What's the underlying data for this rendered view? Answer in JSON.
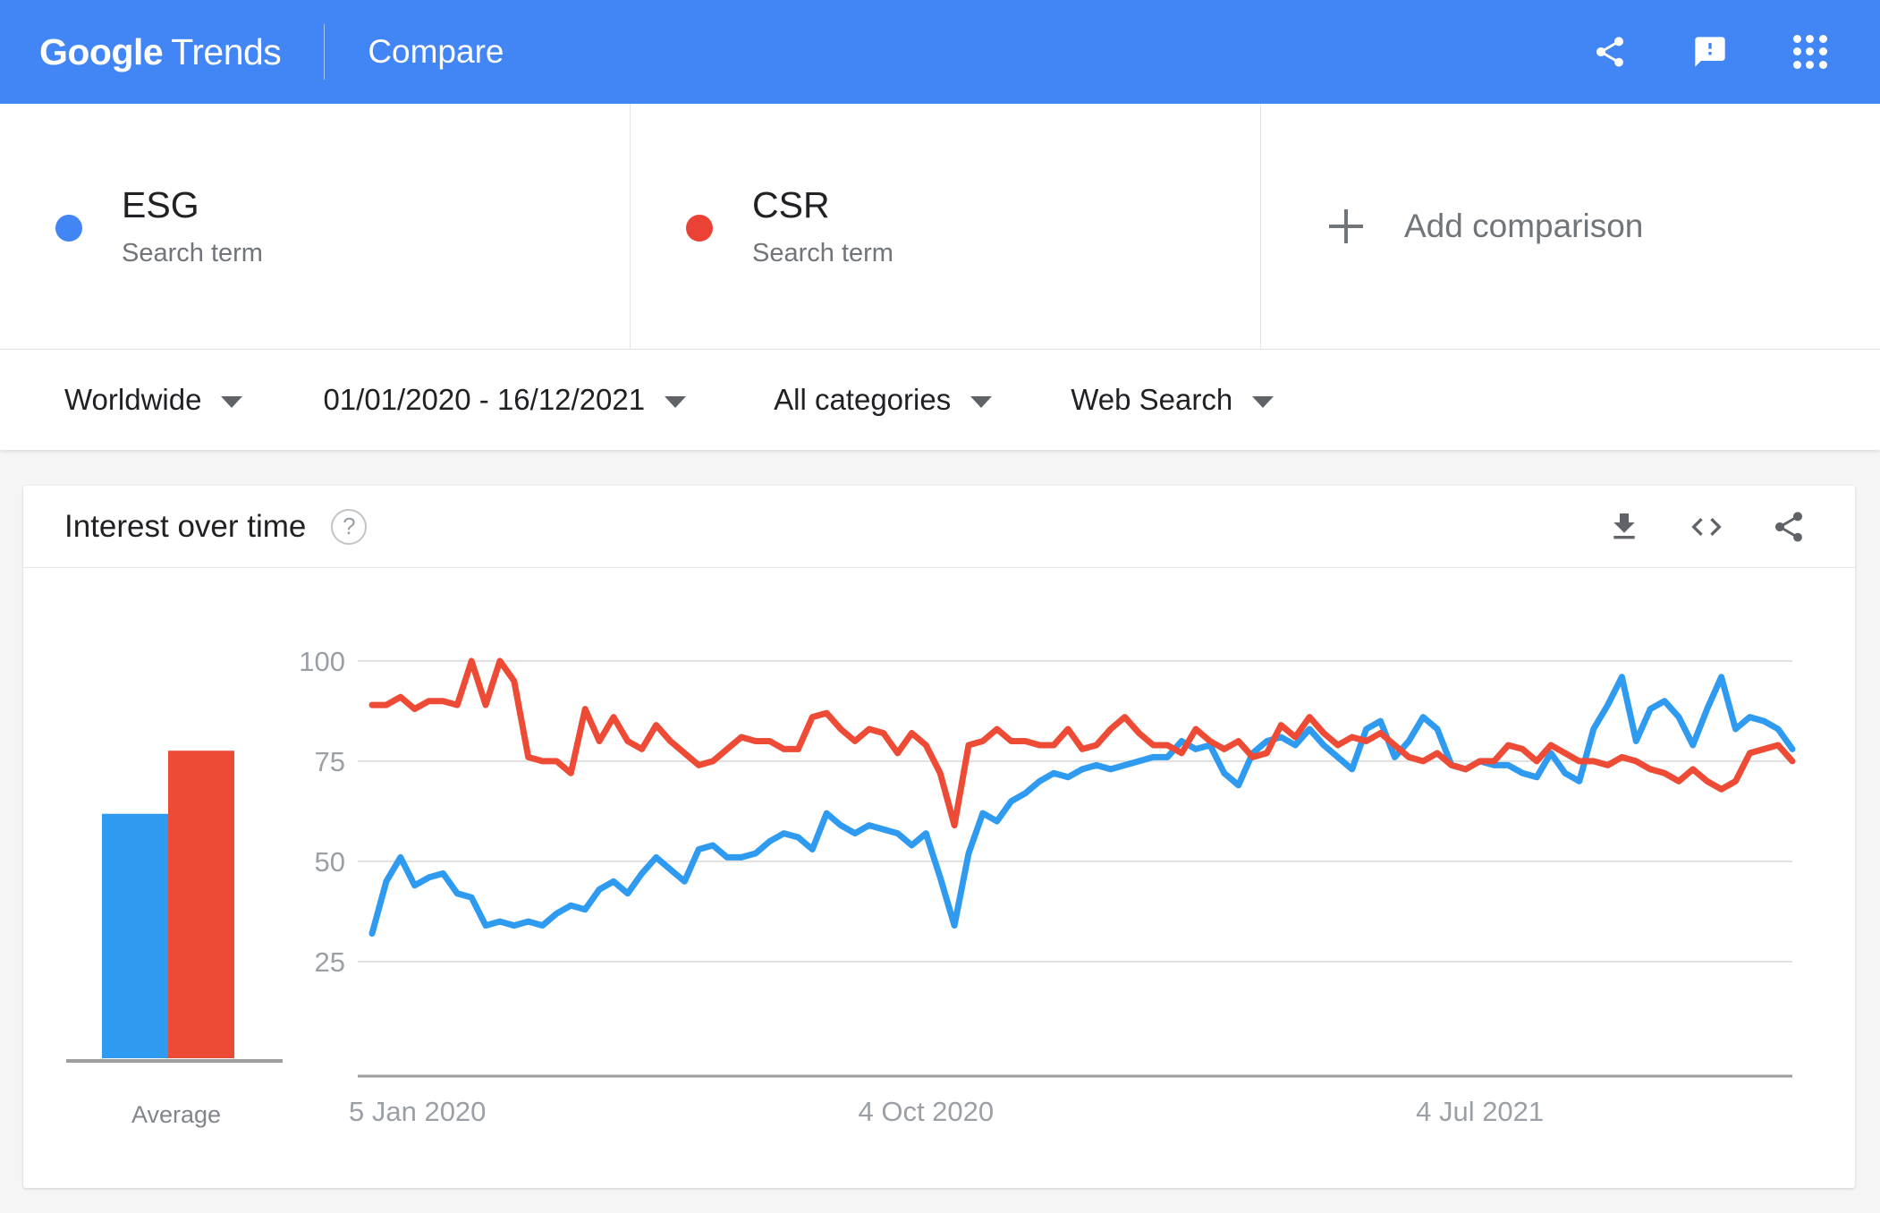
{
  "header": {
    "brand_google": "Google",
    "brand_trends": "Trends",
    "page_title": "Compare",
    "actions": [
      {
        "name": "share-icon",
        "label": "Share"
      },
      {
        "name": "feedback-icon",
        "label": "Send feedback"
      },
      {
        "name": "apps-grid-icon",
        "label": "Google apps"
      }
    ]
  },
  "compare": {
    "terms": [
      {
        "name": "ESG",
        "type": "Search term",
        "color": "#4285F4"
      },
      {
        "name": "CSR",
        "type": "Search term",
        "color": "#EA4335"
      }
    ],
    "add_label": "Add comparison"
  },
  "filters": [
    {
      "key": "location",
      "value": "Worldwide"
    },
    {
      "key": "time_range",
      "value": "01/01/2020 - 16/12/2021"
    },
    {
      "key": "category",
      "value": "All categories"
    },
    {
      "key": "search_type",
      "value": "Web Search"
    }
  ],
  "card": {
    "title": "Interest over time",
    "help_glyph": "?",
    "actions": [
      {
        "name": "download-icon",
        "label": "Download CSV"
      },
      {
        "name": "embed-icon",
        "label": "Embed"
      },
      {
        "name": "share-icon",
        "label": "Share"
      }
    ]
  },
  "chart_data": {
    "type": "line",
    "title": "Interest over time",
    "xlabel": "",
    "ylabel": "",
    "ylim": [
      0,
      108
    ],
    "yticks": [
      100,
      75,
      50,
      25
    ],
    "grid": true,
    "legend": "none",
    "xticks": [
      {
        "label": "5 Jan 2020",
        "index": 0
      },
      {
        "label": "4 Oct 2020",
        "index": 39
      },
      {
        "label": "4 Jul 2021",
        "index": 78
      }
    ],
    "series": [
      {
        "name": "ESG",
        "color": "#2E9BF0",
        "values": [
          32,
          45,
          51,
          44,
          46,
          47,
          42,
          41,
          34,
          35,
          34,
          35,
          34,
          37,
          39,
          38,
          43,
          45,
          42,
          47,
          51,
          48,
          45,
          53,
          54,
          51,
          51,
          52,
          55,
          57,
          56,
          53,
          62,
          59,
          57,
          59,
          58,
          57,
          54,
          57,
          46,
          34,
          52,
          62,
          60,
          65,
          67,
          70,
          72,
          71,
          73,
          74,
          73,
          74,
          75,
          76,
          76,
          80,
          78,
          79,
          72,
          69,
          77,
          80,
          81,
          79,
          83,
          79,
          76,
          73,
          83,
          85,
          76,
          80,
          86,
          83,
          74,
          73,
          75,
          74,
          74,
          72,
          71,
          77,
          72,
          70,
          83,
          89,
          96,
          80,
          88,
          90,
          86,
          79,
          88,
          96,
          83,
          86,
          85,
          83,
          78
        ]
      },
      {
        "name": "CSR",
        "color": "#EE4B36",
        "values": [
          89,
          89,
          91,
          88,
          90,
          90,
          89,
          100,
          89,
          100,
          95,
          76,
          75,
          75,
          72,
          88,
          80,
          86,
          80,
          78,
          84,
          80,
          77,
          74,
          75,
          78,
          81,
          80,
          80,
          78,
          78,
          86,
          87,
          83,
          80,
          83,
          82,
          77,
          82,
          79,
          72,
          59,
          79,
          80,
          83,
          80,
          80,
          79,
          79,
          83,
          78,
          79,
          83,
          86,
          82,
          79,
          79,
          77,
          83,
          80,
          78,
          80,
          76,
          77,
          84,
          81,
          86,
          82,
          79,
          81,
          80,
          82,
          79,
          76,
          75,
          77,
          74,
          73,
          75,
          75,
          79,
          78,
          75,
          79,
          77,
          75,
          75,
          74,
          76,
          75,
          73,
          72,
          70,
          73,
          70,
          68,
          70,
          77,
          78,
          79,
          75
        ]
      }
    ],
    "average_bars": {
      "label": "Average",
      "categories": [
        "ESG",
        "CSR"
      ],
      "values": [
        62,
        78
      ],
      "colors": [
        "#2E9BF0",
        "#EE4B36"
      ]
    }
  }
}
